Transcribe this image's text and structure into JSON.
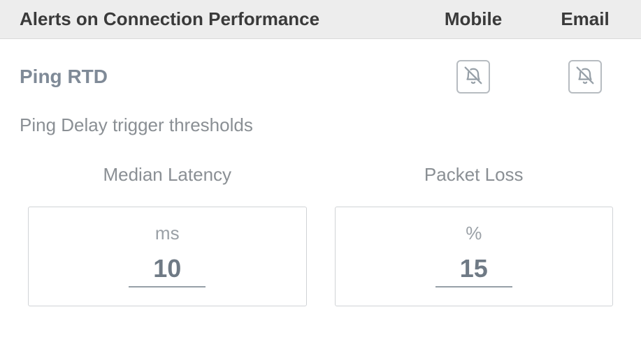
{
  "header": {
    "title": "Alerts on Connection Performance",
    "col_mobile": "Mobile",
    "col_email": "Email"
  },
  "section": {
    "title": "Ping RTD",
    "subtitle": "Ping Delay trigger thresholds",
    "mobile_alert_enabled": false,
    "email_alert_enabled": false
  },
  "thresholds": {
    "median_latency": {
      "label": "Median Latency",
      "unit": "ms",
      "value": "10"
    },
    "packet_loss": {
      "label": "Packet Loss",
      "unit": "%",
      "value": "15"
    }
  },
  "icons": {
    "bell_off": "bell-off-icon"
  },
  "colors": {
    "header_bg": "#ededed",
    "muted_text": "#8a8f94",
    "border": "#d0d3d6"
  }
}
